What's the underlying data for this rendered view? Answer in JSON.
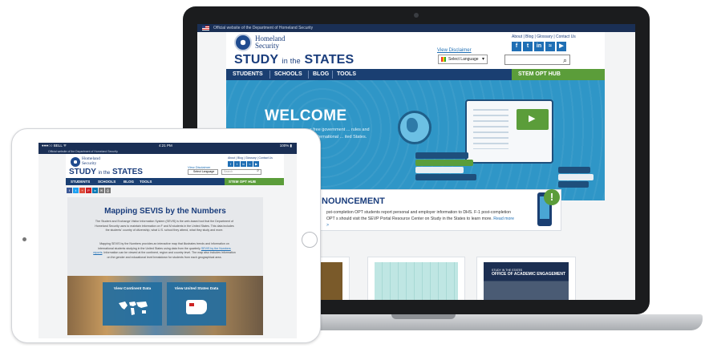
{
  "site": {
    "gov_banner": "Official website of the Department of Homeland Security",
    "agency_line1": "Homeland",
    "agency_line2": "Security",
    "brand_study": "STUDY",
    "brand_in_the": "in the",
    "brand_states": "STATES",
    "utility_links": "About | Blog | Glossary | Contact Us",
    "view_disclaimer": "View Disclaimer",
    "language_select": "Select Language",
    "social_icons": [
      "facebook-icon",
      "twitter-icon",
      "linkedin-icon",
      "rss-icon",
      "youtube-icon"
    ],
    "social_glyphs": [
      "f",
      "t",
      "in",
      "≈",
      "▶"
    ]
  },
  "laptop": {
    "nav": [
      "STUDENTS",
      "SCHOOLS",
      "BLOG",
      "TOOLS"
    ],
    "stem_opt_hub": "STEM OPT HUB",
    "hero_title": "WELCOME",
    "hero_body": "s free government ... rules and ... international ... ited States.",
    "announcement_title": "NOUNCEMENT",
    "announcement_body": "pst-completion OPT students report personal and employer information  to DHS. F-1 post-completion OPT s should visit the SEVP Portal Resource Center on Study in the States to learn more.",
    "read_more": "Read more >",
    "card3_caption_top": "STUDY IN THE STATES",
    "card3_caption": "OFFICE OF ACADEMIC ENGAGEMENT",
    "alert_glyph": "!"
  },
  "tablet": {
    "status_carrier": "●●●○○ BELL ᯤ",
    "status_time": "4:21 PM",
    "status_battery": "100% ▮",
    "nav": [
      "STUDENTS",
      "SCHOOLS",
      "BLOG",
      "TOOLS"
    ],
    "stem_opt_hub": "STEM OPT HUB",
    "search_placeholder": "Search",
    "share_glyphs": [
      "f",
      "t",
      "+",
      "P",
      "in",
      "✉",
      "⎙"
    ],
    "page_title": "Mapping SEVIS by the Numbers",
    "para1": "The Student and Exchange Visitor Information System (SEVIS) is the web-based tool that the Department of Homeland Security uses to maintain information on F and M students in the United States. This data includes the students' country of citizenship, what U.S. school they attend, what they study and more.",
    "para2_a": "Mapping SEVIS by the Numbers provides an interactive map that illustrates trends and information on international students studying in the United States using data from the quarterly",
    "para2_link": "SEVIS by the Numbers reports",
    "para2_b": ". Information can be viewed at the continent, region and country level. The map also includes information on the gender and educational level breakdown for students from each geographical area.",
    "btn_continent": "View Continent Data",
    "btn_us": "View United States Data"
  }
}
